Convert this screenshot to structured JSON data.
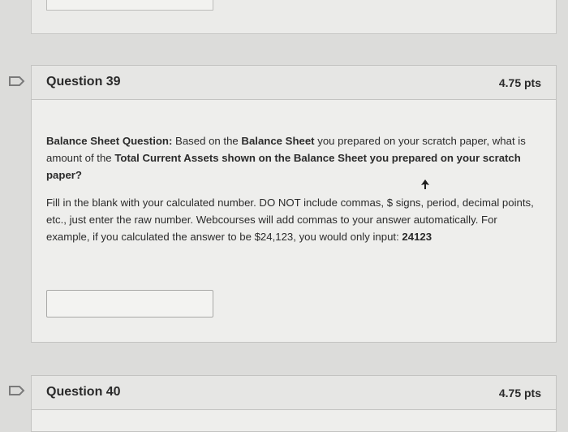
{
  "q39": {
    "title": "Question 39",
    "points": "4.75 pts",
    "p1": {
      "b1": "Balance Sheet Question:",
      "t1": " Based on the ",
      "b2": "Balance Sheet",
      "t2": " you prepared on your scratch paper, what is amount of the ",
      "b3": "Total Current Assets shown on the Balance Sheet you prepared on your scratch paper?"
    },
    "p2": {
      "t1": "Fill in the blank with your calculated number. DO NOT include commas, $ signs, period, decimal points, etc., just enter the raw number. Webcourses will add commas to your answer automatically.  For example, if you calculated the answer to be $24,123, you would only input: ",
      "b1": "24123"
    },
    "answer_value": ""
  },
  "q40": {
    "title": "Question 40",
    "points": "4.75 pts"
  },
  "icons": {
    "flag": "flag-outline-icon",
    "cursor": "mouse-pointer-icon"
  },
  "colors": {
    "background": "#dcdcda",
    "card": "#eeeeec",
    "border": "#c3c3c1"
  }
}
